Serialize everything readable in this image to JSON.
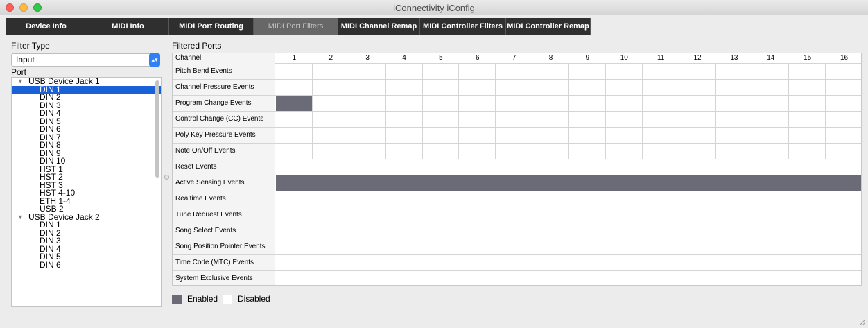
{
  "window": {
    "title": "iConnectivity iConfig"
  },
  "tabs": [
    {
      "label": "Device Info",
      "active": false
    },
    {
      "label": "MIDI Info",
      "active": false
    },
    {
      "label": "MIDI Port Routing",
      "active": false
    },
    {
      "label": "MIDI Port Filters",
      "active": true
    },
    {
      "label": "MIDI Channel Remap",
      "active": false
    },
    {
      "label": "MIDI Controller Filters",
      "active": false
    },
    {
      "label": "MIDI Controller Remap",
      "active": false
    }
  ],
  "filter_type": {
    "label": "Filter Type",
    "value": "Input"
  },
  "port": {
    "label": "Port",
    "items": [
      {
        "label": "USB Device Jack 1",
        "level": 0,
        "expanded": true,
        "selected": false
      },
      {
        "label": "DIN 1",
        "level": 1,
        "selected": true
      },
      {
        "label": "DIN 2",
        "level": 1,
        "selected": false
      },
      {
        "label": "DIN 3",
        "level": 1,
        "selected": false
      },
      {
        "label": "DIN 4",
        "level": 1,
        "selected": false
      },
      {
        "label": "DIN 5",
        "level": 1,
        "selected": false
      },
      {
        "label": "DIN 6",
        "level": 1,
        "selected": false
      },
      {
        "label": "DIN 7",
        "level": 1,
        "selected": false
      },
      {
        "label": "DIN 8",
        "level": 1,
        "selected": false
      },
      {
        "label": "DIN 9",
        "level": 1,
        "selected": false
      },
      {
        "label": "DIN 10",
        "level": 1,
        "selected": false
      },
      {
        "label": "HST 1",
        "level": 1,
        "selected": false
      },
      {
        "label": "HST 2",
        "level": 1,
        "selected": false
      },
      {
        "label": "HST 3",
        "level": 1,
        "selected": false
      },
      {
        "label": "HST 4-10",
        "level": 1,
        "selected": false
      },
      {
        "label": "ETH 1-4",
        "level": 1,
        "selected": false
      },
      {
        "label": "USB 2",
        "level": 1,
        "selected": false
      },
      {
        "label": "USB Device Jack 2",
        "level": 0,
        "expanded": true,
        "selected": false
      },
      {
        "label": "DIN 1",
        "level": 1,
        "selected": false
      },
      {
        "label": "DIN 2",
        "level": 1,
        "selected": false
      },
      {
        "label": "DIN 3",
        "level": 1,
        "selected": false
      },
      {
        "label": "DIN 4",
        "level": 1,
        "selected": false
      },
      {
        "label": "DIN 5",
        "level": 1,
        "selected": false
      },
      {
        "label": "DIN 6",
        "level": 1,
        "selected": false
      }
    ]
  },
  "filtered_ports": {
    "label": "Filtered Ports",
    "channel_header": "Channel",
    "channels": [
      "1",
      "2",
      "3",
      "4",
      "5",
      "6",
      "7",
      "8",
      "9",
      "10",
      "11",
      "12",
      "13",
      "14",
      "15",
      "16"
    ],
    "channel_rows": [
      {
        "name": "Pitch Bend Events",
        "enabled": []
      },
      {
        "name": "Channel Pressure Events",
        "enabled": []
      },
      {
        "name": "Program Change Events",
        "enabled": [
          1
        ]
      },
      {
        "name": "Control Change (CC) Events",
        "enabled": []
      },
      {
        "name": "Poly Key Pressure Events",
        "enabled": []
      },
      {
        "name": "Note On/Off Events",
        "enabled": []
      }
    ],
    "system_rows": [
      {
        "name": "Reset Events",
        "enabled": false
      },
      {
        "name": "Active Sensing Events",
        "enabled": true
      },
      {
        "name": "Realtime Events",
        "enabled": false
      },
      {
        "name": "Tune Request Events",
        "enabled": false
      },
      {
        "name": "Song Select Events",
        "enabled": false
      },
      {
        "name": "Song Position Pointer Events",
        "enabled": false
      },
      {
        "name": "Time Code (MTC) Events",
        "enabled": false
      },
      {
        "name": "System Exclusive Events",
        "enabled": false
      }
    ]
  },
  "legend": {
    "enabled": "Enabled",
    "disabled": "Disabled"
  },
  "colors": {
    "enabled": "#6b6b77",
    "selection": "#1a60d6",
    "tab_bar": "#2f2f2f"
  }
}
